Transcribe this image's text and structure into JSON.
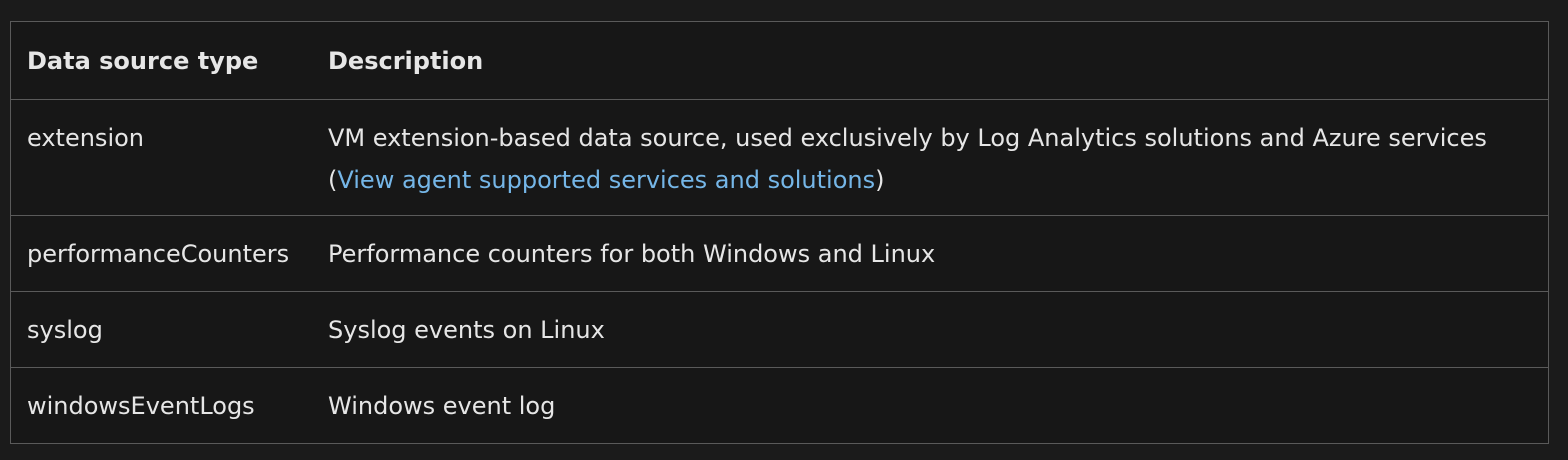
{
  "table": {
    "headers": [
      "Data source type",
      "Description"
    ],
    "rows": [
      {
        "type": "extension",
        "description": "VM extension-based data source, used exclusively by Log Analytics solutions and Azure services",
        "link_open": "(",
        "link_text": "View agent supported services and solutions",
        "link_close": ")"
      },
      {
        "type": "performanceCounters",
        "description": "Performance counters for both Windows and Linux"
      },
      {
        "type": "syslog",
        "description": "Syslog events on Linux"
      },
      {
        "type": "windowsEventLogs",
        "description": "Windows event log"
      }
    ]
  },
  "colors": {
    "background": "#1b1b1b",
    "table_background": "#171717",
    "border": "#5a5a5a",
    "text": "#e6e6e6",
    "link": "#75b6e7"
  }
}
